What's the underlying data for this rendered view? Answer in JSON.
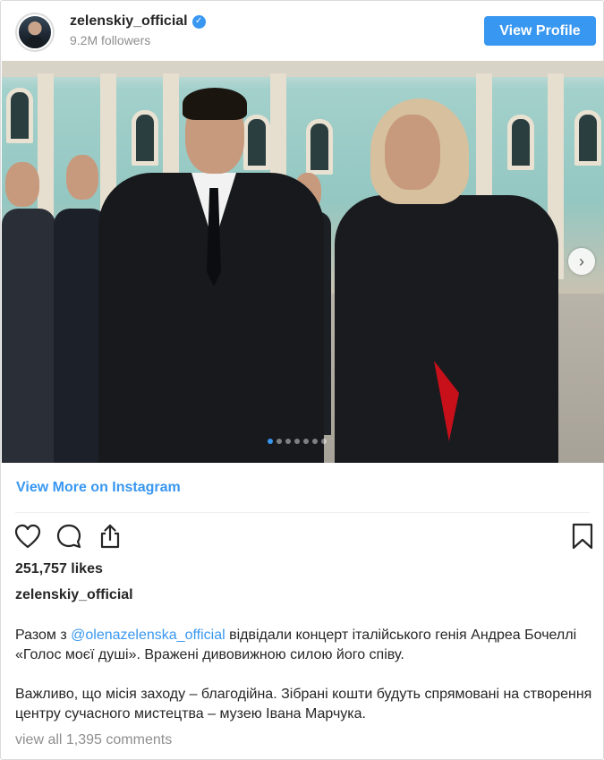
{
  "header": {
    "username": "zelenskiy_official",
    "verified": true,
    "followers": "9.2M followers",
    "view_profile_label": "View Profile"
  },
  "post": {
    "carousel": {
      "slides": 7,
      "active_index": 0,
      "next_icon": "chevron-right-icon"
    },
    "view_more_label": "View More on Instagram",
    "actions": {
      "like_icon": "heart-icon",
      "comment_icon": "comment-icon",
      "share_icon": "share-icon",
      "save_icon": "bookmark-icon"
    },
    "likes": "251,757 likes",
    "author": "zelenskiy_official",
    "caption": {
      "p1_prefix": "Разом з ",
      "mention": "@olenazelenska_official",
      "p1_suffix": " відвідали концерт італійського генія Андреа Бочеллі «Голос моєї душі». Вражені дивовижною силою його співу.",
      "p2": "Важливо, що місія заходу – благодійна. Зібрані кошти будуть спрямовані на створення центру сучасного мистецтва – музею Івана Марчука."
    },
    "comments_link": "view all 1,395 comments"
  },
  "colors": {
    "accent": "#3897f0",
    "text": "#262626",
    "muted": "#8e8e8e",
    "border": "#dbdbdb"
  }
}
